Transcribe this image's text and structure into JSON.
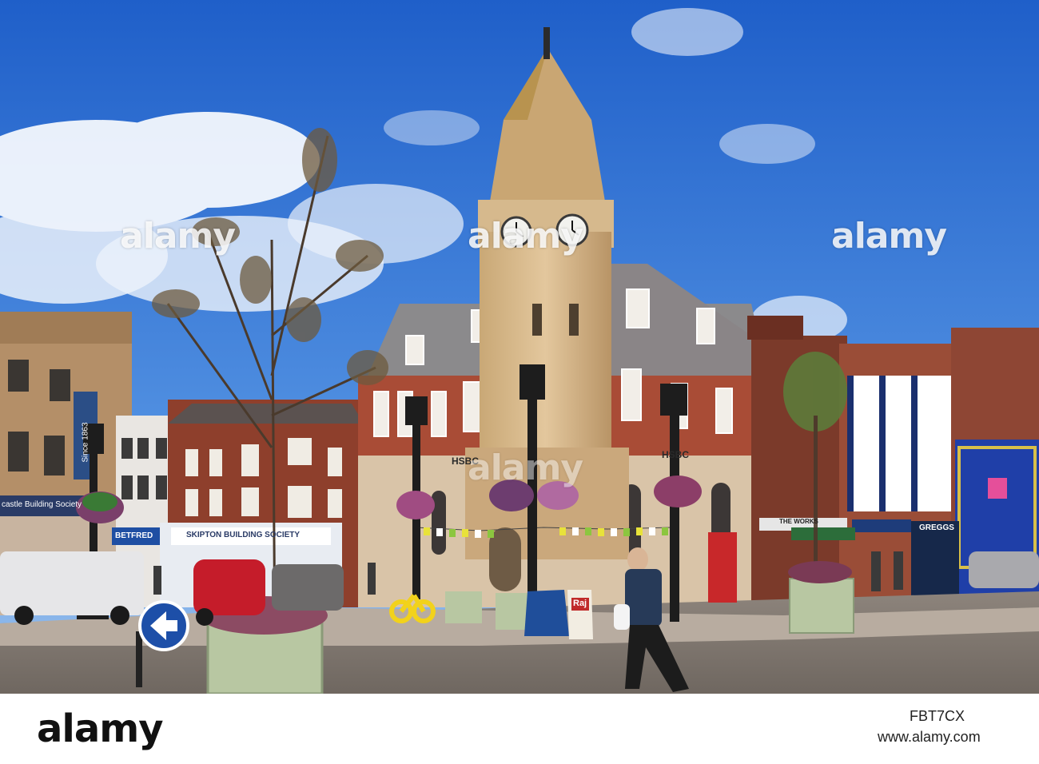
{
  "watermarks": [
    "alamy",
    "alamy",
    "alamy",
    "alamy"
  ],
  "footer": {
    "logo": "alamy",
    "image_id": "FBT7CX",
    "url": "www.alamy.com"
  },
  "signs": {
    "hsbc_left": "HSBC",
    "hsbc_right": "HSBC",
    "skipton": "SKIPTON BUILDING SOCIETY",
    "the_works": "THE WORKS",
    "greggs": "GREGGS",
    "betfred": "BETFRED",
    "newcastle": "castle Building Society",
    "since": "Since 1863",
    "raj": "Raj"
  },
  "colors": {
    "sky": "#2f6fd3",
    "stone": "#d8b98e",
    "brick": "#8e3f2c"
  }
}
